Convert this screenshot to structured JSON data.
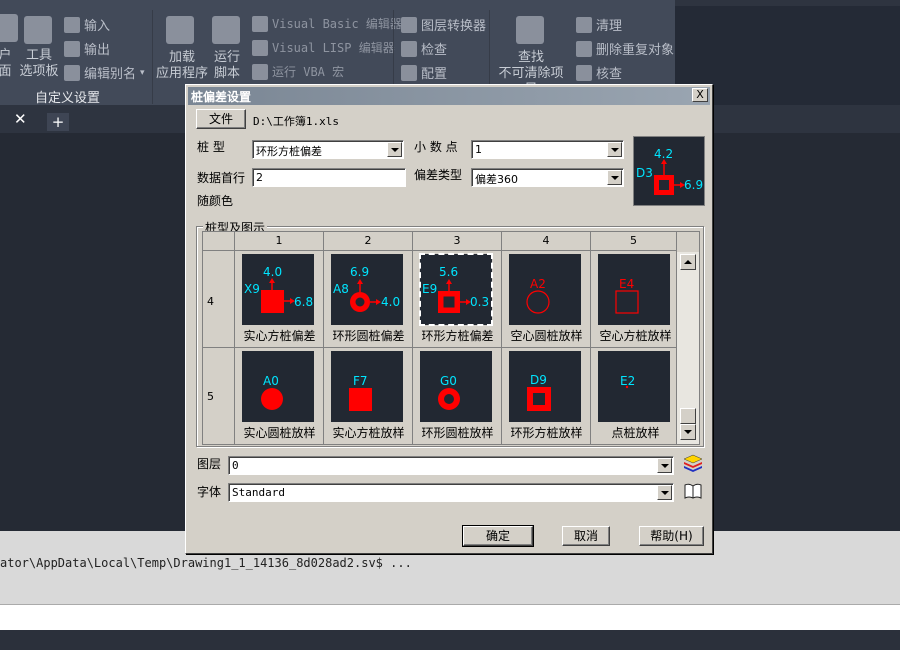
{
  "ribbon": {
    "panel_buttons": {
      "input": "输入",
      "output": "输出",
      "edit_alias": "编辑别名",
      "tool_palette_line1": "工具",
      "tool_palette_line2": "选项板",
      "user_iface_line1": "户",
      "user_iface_line2": "面",
      "load_app_line1": "加载",
      "load_app_line2": "应用程序",
      "run_script_line1": "运行",
      "run_script_line2": "脚本",
      "vb_editor": "Visual Basic 编辑器",
      "vlisp_editor": "Visual LISP 编辑器",
      "run_vba": "运行 VBA 宏",
      "layer_translator": "图层转换器",
      "check": "检查",
      "config": "配置",
      "find_line1": "查找",
      "find_line2": "不可清除项目",
      "purge": "清理",
      "delete_duplicates": "删除重复对象",
      "audit": "核查"
    },
    "group_label": "自定义设置"
  },
  "command_line": {
    "history": "ator\\AppData\\Local\\Temp\\Drawing1_1_14136_8d028ad2.sv$ ..."
  },
  "dialog": {
    "title": "桩偏差设置",
    "close_label": "X",
    "file_button": "文件",
    "file_path": "D:\\工作簿1.xls",
    "pile_type_label": "桩    型",
    "pile_type_value": "环形方桩偏差",
    "decimals_label": "小 数 点",
    "decimals_value": "1",
    "data_first_row_label": "数据首行",
    "data_first_row_value": "2",
    "deviation_type_label": "偏差类型",
    "deviation_type_value": "偏差360",
    "by_color_label": "随颜色",
    "group_title": "桩型及图示",
    "columns": [
      "1",
      "2",
      "3",
      "4",
      "5"
    ],
    "rows": [
      {
        "header": "4",
        "cells": [
          {
            "label": "实心方桩偏差",
            "id": "X9",
            "up": "4.0",
            "right": "6.8"
          },
          {
            "label": "环形圆桩偏差",
            "id": "A8",
            "up": "6.9",
            "right": "4.0"
          },
          {
            "label": "环形方桩偏差",
            "id": "E9",
            "up": "5.6",
            "right": "0.3"
          },
          {
            "label": "空心圆桩放样",
            "id": "A2"
          },
          {
            "label": "空心方桩放样",
            "id": "E4"
          }
        ]
      },
      {
        "header": "5",
        "cells": [
          {
            "label": "实心圆桩放样",
            "id": "A0"
          },
          {
            "label": "实心方桩放样",
            "id": "F7"
          },
          {
            "label": "环形圆桩放样",
            "id": "G0"
          },
          {
            "label": "环形方桩放样",
            "id": "D9"
          },
          {
            "label": "点桩放样",
            "id": "E2"
          }
        ]
      }
    ],
    "preview": {
      "id": "D3",
      "up": "4.2",
      "right": "6.9"
    },
    "layer_label": "图层",
    "layer_value": "0",
    "font_label": "字体",
    "font_value": "Standard",
    "ok_button": "确定",
    "cancel_button": "取消",
    "help_button": "帮助(H)"
  },
  "colors": {
    "pile_red": "#ff0000",
    "annotation_cyan": "#00e5ff",
    "tile_bg": "#222832"
  },
  "icons": [
    "close-icon",
    "dropdown-arrow-icon",
    "layer-stack-icon",
    "book-icon",
    "scroll-up-icon",
    "scroll-down-icon",
    "plus-icon"
  ]
}
